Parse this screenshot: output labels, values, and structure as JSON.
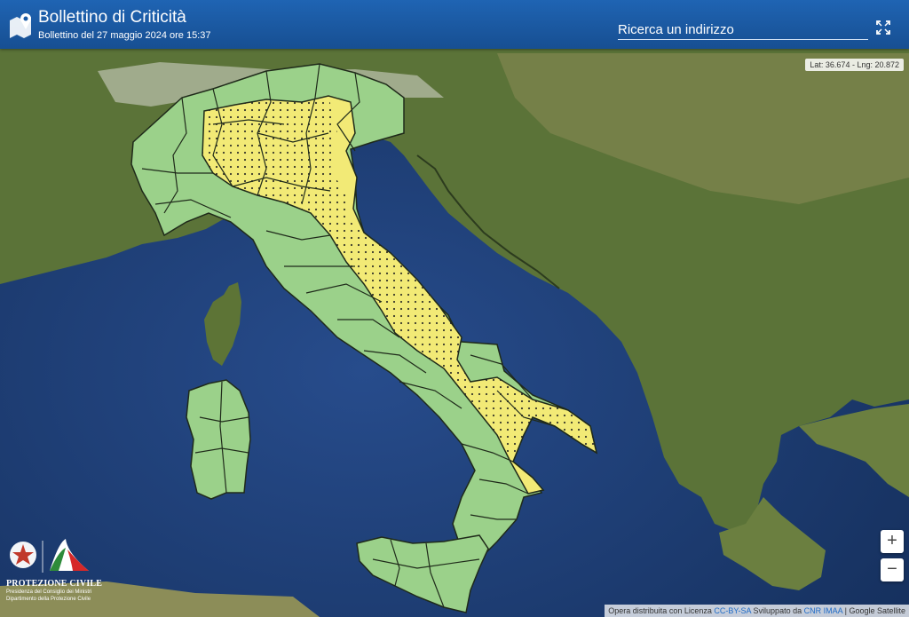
{
  "header": {
    "title": "Bollettino di Criticità",
    "subtitle": "Bollettino del 27 maggio 2024 ore 15:37",
    "search_placeholder": "Ricerca un indirizzo"
  },
  "coords": {
    "text": "Lat: 36.674 - Lng: 20.872"
  },
  "zoom": {
    "in_label": "+",
    "out_label": "−"
  },
  "logo": {
    "name": "PROTEZIONE CIVILE",
    "line1": "Presidenza del Consiglio dei Ministri",
    "line2": "Dipartimento della Protezione Civile"
  },
  "attribution": {
    "prefix": "Opera distribuita con Licenza ",
    "license": "CC-BY-SA",
    "middle": " Sviluppato da ",
    "developer": "CNR IMAA",
    "suffix": " | Google Satellite"
  },
  "legend_colors": {
    "green": "#9bd18a",
    "yellow": "#f2ea76",
    "sea": "#1d3d72"
  }
}
